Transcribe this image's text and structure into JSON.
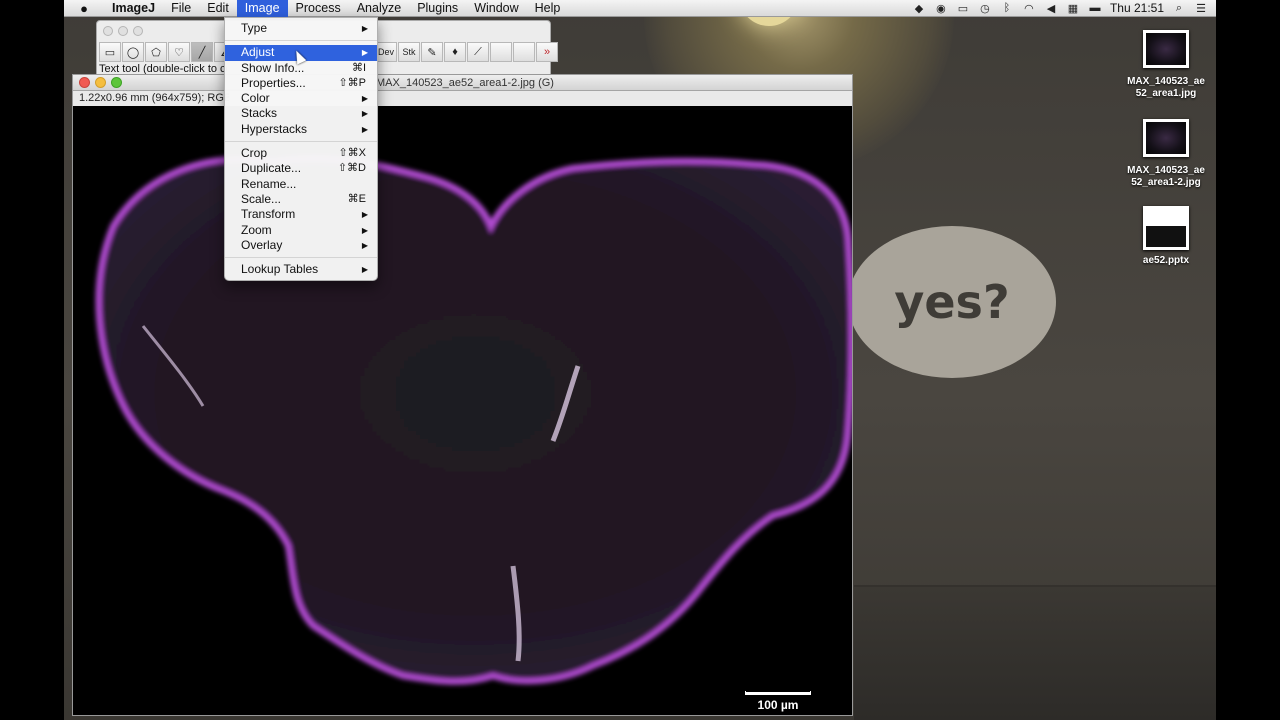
{
  "menubar": {
    "apple_icon": "apple-icon",
    "items": [
      "ImageJ",
      "File",
      "Edit",
      "Image",
      "Process",
      "Analyze",
      "Plugins",
      "Window",
      "Help"
    ],
    "active_item": "Image",
    "clock": "Thu 21:51",
    "status_icons": [
      "dropbox-icon",
      "record-icon",
      "battery-meter-icon",
      "time-machine-icon",
      "bluetooth-icon",
      "wifi-icon",
      "volume-icon",
      "keyboard-icon",
      "battery-icon",
      "spotlight-search-icon",
      "notification-list-icon"
    ]
  },
  "toolbar": {
    "tools": [
      "rectangle",
      "oval",
      "polygon",
      "freehand",
      "line",
      "angle",
      "",
      "",
      "",
      "",
      "",
      "",
      "Dev",
      "Stk",
      "pencil",
      "flood-fill",
      "dropper",
      "",
      "",
      "more"
    ],
    "status_text": "Text tool (double-click to configure)"
  },
  "image_window": {
    "title": "MAX_140523_ae52_area1-2.jpg (G)",
    "info": "1.22x0.96 mm (964x759); RGB; 2.8MB",
    "scalebar_label": "100 µm",
    "tissue_color": "#b04bd0"
  },
  "image_menu": {
    "items": [
      {
        "label": "Type",
        "shortcut": "",
        "submenu": true
      },
      {
        "separator": true
      },
      {
        "label": "Adjust",
        "shortcut": "",
        "submenu": true,
        "highlighted": true
      },
      {
        "label": "Show Info...",
        "shortcut": "⌘I",
        "submenu": false
      },
      {
        "label": "Properties...",
        "shortcut": "⇧⌘P",
        "submenu": false
      },
      {
        "label": "Color",
        "shortcut": "",
        "submenu": true
      },
      {
        "label": "Stacks",
        "shortcut": "",
        "submenu": true
      },
      {
        "label": "Hyperstacks",
        "shortcut": "",
        "submenu": true
      },
      {
        "separator": true
      },
      {
        "label": "Crop",
        "shortcut": "⇧⌘X",
        "submenu": false
      },
      {
        "label": "Duplicate...",
        "shortcut": "⇧⌘D",
        "submenu": false
      },
      {
        "label": "Rename...",
        "shortcut": "",
        "submenu": false
      },
      {
        "label": "Scale...",
        "shortcut": "⌘E",
        "submenu": false
      },
      {
        "label": "Transform",
        "shortcut": "",
        "submenu": true
      },
      {
        "label": "Zoom",
        "shortcut": "",
        "submenu": true
      },
      {
        "label": "Overlay",
        "shortcut": "",
        "submenu": true
      },
      {
        "separator": true
      },
      {
        "label": "Lookup Tables",
        "shortcut": "",
        "submenu": true
      }
    ]
  },
  "desktop": {
    "speech_text": "yes?",
    "icons": [
      {
        "label": "MAX_140523_ae52_area1.jpg",
        "line1": "MAX_140523_ae",
        "line2": "52_area1.jpg",
        "kind": "image"
      },
      {
        "label": "MAX_140523_ae52_area1-2.jpg",
        "line1": "MAX_140523_ae",
        "line2": "52_area1-2.jpg",
        "kind": "image"
      },
      {
        "label": "ae52.pptx",
        "line1": "ae52.pptx",
        "line2": "",
        "kind": "pptx"
      }
    ]
  }
}
